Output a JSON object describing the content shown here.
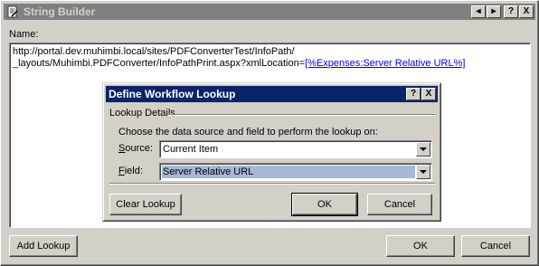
{
  "window": {
    "title": "String Builder",
    "buttons": [
      "◂",
      "▸",
      "?",
      "X"
    ]
  },
  "name_label": "Name:",
  "textarea": {
    "line1": "http://portal.dev.muhimbi.local/sites/PDFConverterTest/InfoPath/",
    "line2_prefix": "_layouts/Muhimbi.PDFConverter/InfoPathPrint.aspx?xmlLocation=",
    "line2_token": "[%Expenses:Server Relative URL%]"
  },
  "footer": {
    "add_lookup": "Add Lookup",
    "ok": "OK",
    "cancel": "Cancel"
  },
  "dialog": {
    "title": "Define Workflow Lookup",
    "help": "?",
    "close": "X",
    "group_label": "Lookup Details",
    "instruction": "Choose the data source and field to perform the lookup on:",
    "source_label_accel": "S",
    "source_label_rest": "ource:",
    "source_value": "Current Item",
    "field_label_accel": "F",
    "field_label_rest": "ield:",
    "field_value": "Server Relative URL",
    "clear_lookup": "Clear Lookup",
    "ok": "OK",
    "cancel": "Cancel"
  },
  "icons": {
    "app": "document-edit-icon",
    "dropdown": "chevron-down-icon"
  }
}
